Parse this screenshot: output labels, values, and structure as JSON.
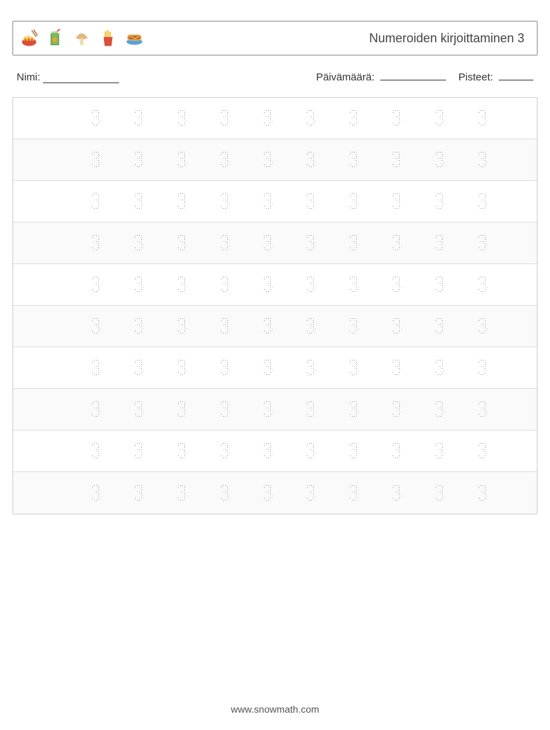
{
  "header": {
    "title": "Numeroiden kirjoittaminen 3",
    "icons": [
      "noodle-bowl-icon",
      "juice-box-icon",
      "mushroom-icon",
      "fries-icon",
      "hotdog-icon"
    ]
  },
  "meta": {
    "name_label": "Nimi:",
    "date_label": "Päivämäärä:",
    "score_label": "Pisteet:"
  },
  "practice": {
    "digit": "3",
    "rows": 10,
    "cols": 10
  },
  "footer": {
    "url": "www.snowmath.com"
  }
}
